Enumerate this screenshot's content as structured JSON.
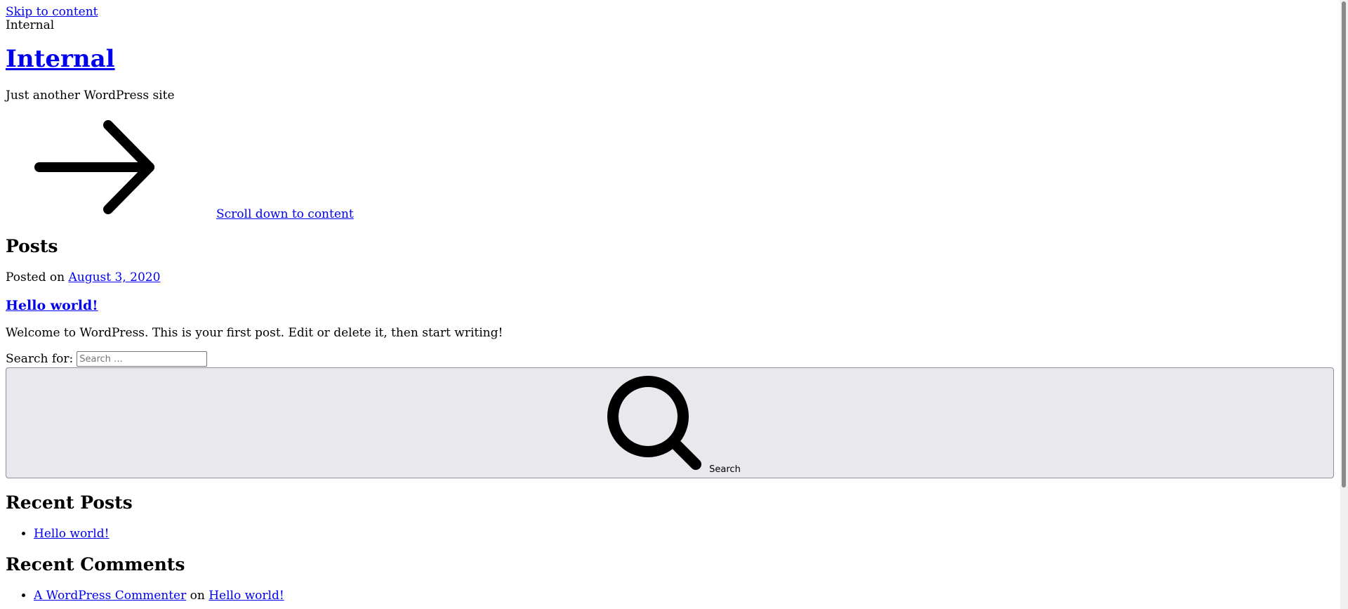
{
  "skip_link": "Skip to content",
  "site": {
    "name_small": "Internal",
    "title": "Internal",
    "tagline": "Just another WordPress site"
  },
  "scroll_link": {
    "label": "Scroll down to content",
    "icon": "arrow-right-icon"
  },
  "main": {
    "posts_heading": "Posts",
    "post": {
      "posted_on_prefix": "Posted on",
      "date": "August 3, 2020",
      "title": "Hello world!",
      "excerpt": "Welcome to WordPress. This is your first post. Edit or delete it, then start writing!"
    }
  },
  "search": {
    "label": "Search for:",
    "placeholder": "Search …",
    "value": "",
    "button_label": "Search",
    "icon": "search-icon"
  },
  "recent_posts": {
    "heading": "Recent Posts",
    "items": [
      "Hello world!"
    ]
  },
  "recent_comments": {
    "heading": "Recent Comments",
    "items": [
      {
        "author": "A WordPress Commenter",
        "connector": "on",
        "post": "Hello world!"
      }
    ]
  },
  "colors": {
    "link": "#0000ee",
    "button_bg": "#e9e9ed",
    "button_border": "#8f8f9d"
  }
}
